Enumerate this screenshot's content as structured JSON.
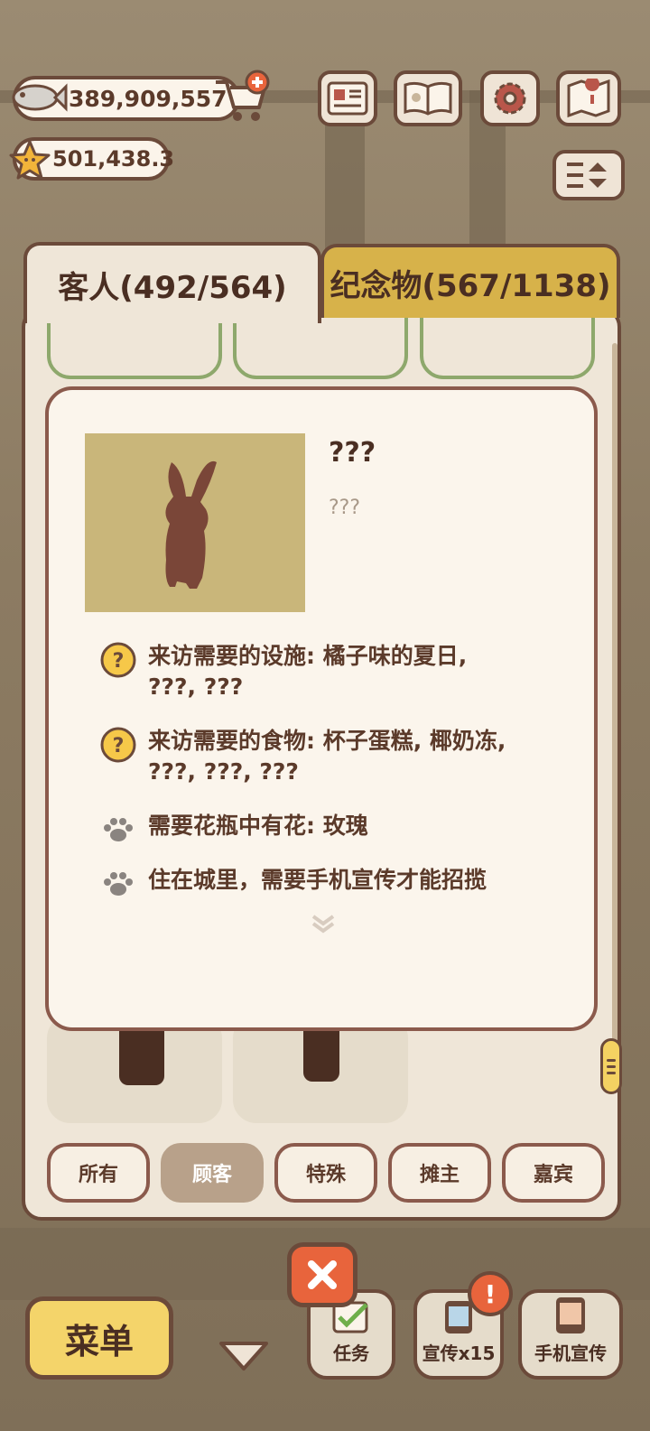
{
  "hud": {
    "fish_currency": "389,909,557",
    "star_currency": "501,438.3"
  },
  "tabs": {
    "guests_label": "客人(492/564)",
    "souvenirs_label": "纪念物(567/1138)"
  },
  "detail": {
    "name": "???",
    "subname": "???",
    "requirements": [
      {
        "icon": "question-icon",
        "lines": [
          "来访需要的设施: 橘子味的夏日,",
          "???, ???"
        ]
      },
      {
        "icon": "question-icon",
        "lines": [
          "来访需要的食物: 杯子蛋糕, 椰奶冻,",
          "???, ???, ???"
        ]
      },
      {
        "icon": "paw-icon",
        "lines": [
          "需要花瓶中有花: 玫瑰"
        ]
      },
      {
        "icon": "paw-icon",
        "lines": [
          "住在城里，需要手机宣传才能招揽"
        ]
      }
    ]
  },
  "filters": [
    "所有",
    "顾客",
    "特殊",
    "摊主",
    "嘉宾"
  ],
  "active_filter": "顾客",
  "bottom": {
    "menu_label": "菜单",
    "task_label": "任务",
    "promo_label": "宣传x15",
    "phone_promo_label": "手机宣传",
    "badge": "!"
  },
  "colors": {
    "border": "#6b4a3a",
    "tab_inactive": "#d7b24a",
    "portrait_bg": "#c9b67a",
    "silhouette": "#7a4638",
    "accent_red": "#e8643c"
  }
}
